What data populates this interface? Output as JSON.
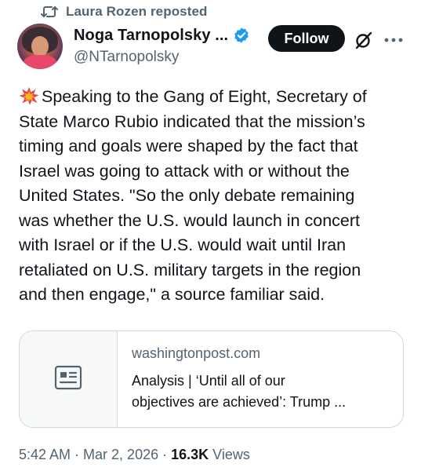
{
  "repost": {
    "icon": "repost-icon",
    "text": "Laura Rozen reposted"
  },
  "author": {
    "avatar": "avatar",
    "display_name": "Noga Tarnopolsky ...",
    "verified_icon": "verified-badge-icon",
    "verified_color": "#1d9bf0",
    "handle": "@NTarnopolsky"
  },
  "actions": {
    "follow_label": "Follow",
    "grok_icon": "grok-icon",
    "more_icon": "more-options-icon"
  },
  "post": {
    "lead_icon": "collision-emoji-icon",
    "lines": [
      "Speaking to the Gang of Eight, Secretary of",
      "State Marco Rubio indicated that the mission’s",
      "timing and goals were shaped by the fact that",
      "Israel was going to attack with or without the",
      "United States. \"So the only debate remaining",
      "was whether the U.S. would launch in concert",
      "with Israel or if the U.S. would wait until Iran",
      "retaliated on U.S. military targets in the region",
      "and then engage,\" a source familiar said."
    ]
  },
  "link_card": {
    "thumb_icon": "article-icon",
    "domain": "washingtonpost.com",
    "title_lines": [
      "Analysis | ‘Until all of our",
      "objectives are achieved’: Trump ..."
    ]
  },
  "meta": {
    "time": "5:42 AM",
    "separator": "·",
    "date": "Mar 2, 2026",
    "views_count": "16.3K",
    "views_label": "Views"
  },
  "colors": {
    "text_primary": "#0f1419",
    "text_secondary": "#536471",
    "border": "#cfd9de",
    "follow_bg": "#0f1419"
  }
}
